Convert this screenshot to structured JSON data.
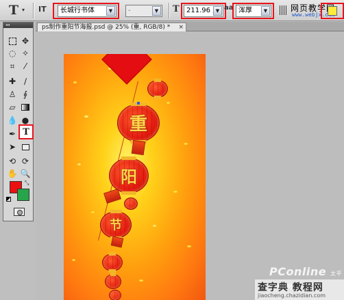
{
  "options_bar": {
    "tool_icon": "T",
    "orientation_icon": "IT",
    "font_family": "长城行书体",
    "font_style": "-",
    "size_icon": "T",
    "font_size": "211.96 点",
    "aa_icon": "aa",
    "antialias": "浑厚",
    "logo_text": "网页教学网",
    "logo_url": "www.webjx.com",
    "highlight_color": "#e8141c"
  },
  "document": {
    "tab_title": "ps制作重阳节海报.psd @ 25% (重, RGB/8) *",
    "close_label": "×"
  },
  "toolbox": {
    "header": "◂◂",
    "type_tool_label": "T",
    "foreground_color": "#ee1010",
    "background_color": "#27a54a"
  },
  "poster": {
    "lantern_glyphs": [
      "重",
      "阳",
      "节"
    ]
  },
  "watermark": {
    "pconline": "PConline",
    "pconline_sub": "太平洋电脑网",
    "chazidian": "查字典 教程网",
    "chazidian_url": "jiaocheng.chazidian.com"
  }
}
